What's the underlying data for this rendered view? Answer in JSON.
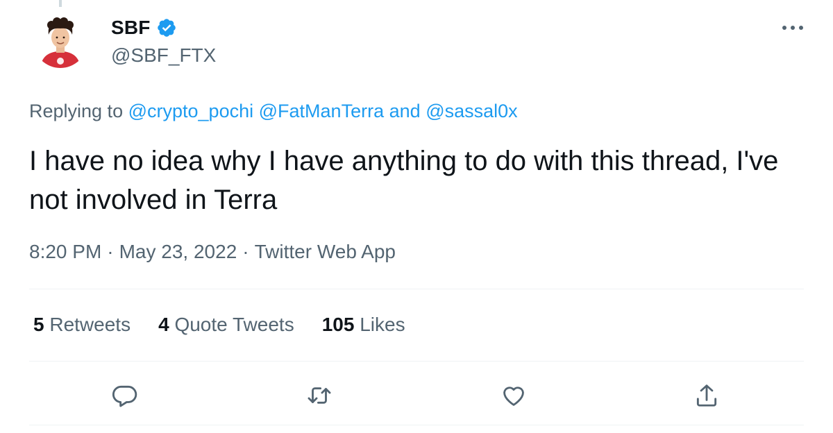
{
  "author": {
    "display_name": "SBF",
    "handle": "@SBF_FTX",
    "verified": true
  },
  "reply_context": {
    "prefix": "Replying to",
    "mention_1": "@crypto_pochi",
    "mention_2": "@FatManTerra",
    "conjunction": "and",
    "mention_3": "@sassal0x"
  },
  "tweet": {
    "text": "I have no idea why I have anything to do with this thread, I've not involved in Terra"
  },
  "meta": {
    "time": "8:20 PM",
    "separator": "·",
    "date": "May 23, 2022",
    "source": "Twitter Web App"
  },
  "stats": {
    "retweets_count": "5",
    "retweets_label": "Retweets",
    "quotes_count": "4",
    "quotes_label": "Quote Tweets",
    "likes_count": "105",
    "likes_label": "Likes"
  },
  "icons": {
    "reply": "reply-icon",
    "retweet": "retweet-icon",
    "like": "heart-icon",
    "share": "share-icon",
    "more": "more-icon",
    "verified": "verified-badge-icon"
  },
  "colors": {
    "accent": "#1d9bf0",
    "text_primary": "#0f1419",
    "text_secondary": "#536471",
    "divider": "#eff3f4"
  }
}
